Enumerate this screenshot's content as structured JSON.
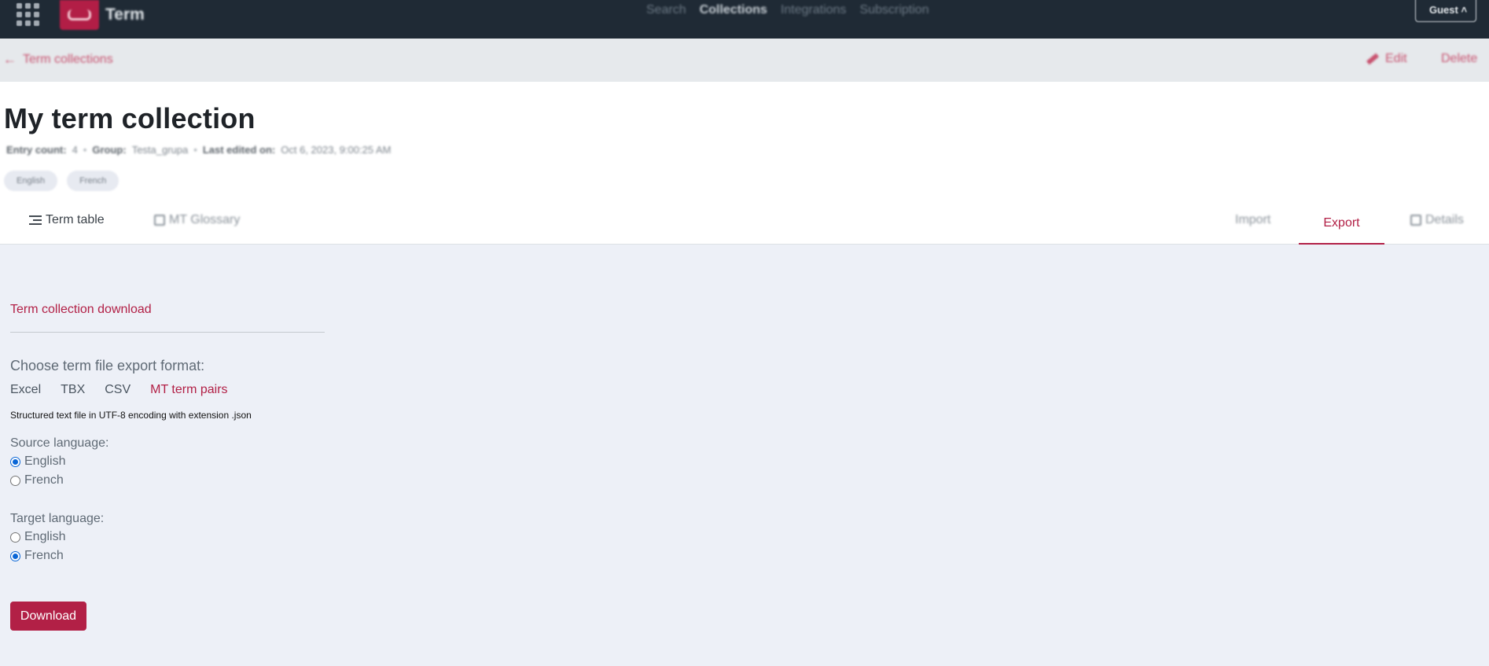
{
  "topbar": {
    "brand": "Term",
    "nav": [
      "Search",
      "Collections",
      "Integrations",
      "Subscription"
    ],
    "active_nav": "Collections",
    "user_button": "Guest"
  },
  "breadcrumb": {
    "back_label": "Term collections",
    "edit_label": "Edit",
    "delete_label": "Delete"
  },
  "collection": {
    "title": "My term collection",
    "entry_count_label": "Entry count:",
    "entry_count": "4",
    "group_label": "Group:",
    "group": "Testa_grupa",
    "last_edited_label": "Last edited on:",
    "last_edited": "Oct 6, 2023, 9:00:25 AM",
    "languages": [
      "English",
      "French"
    ]
  },
  "tabs": {
    "term_table": "Term table",
    "mt_glossary": "MT Glossary",
    "import": "Import",
    "export": "Export",
    "details": "Details",
    "active": "Export"
  },
  "export": {
    "section_title": "Term collection download",
    "choose_label": "Choose term file export format:",
    "formats": [
      "Excel",
      "TBX",
      "CSV",
      "MT term pairs"
    ],
    "selected_format": "MT term pairs",
    "format_description": "Structured text file in UTF-8 encoding with extension .json",
    "source_label": "Source language:",
    "source_options": [
      "English",
      "French"
    ],
    "source_selected": "English",
    "target_label": "Target language:",
    "target_options": [
      "English",
      "French"
    ],
    "target_selected": "French",
    "download_label": "Download"
  },
  "colors": {
    "accent": "#b22046",
    "topbar": "#1f2a35",
    "page_bg": "#edf0f7",
    "radio_checked": "#0a66d6"
  }
}
